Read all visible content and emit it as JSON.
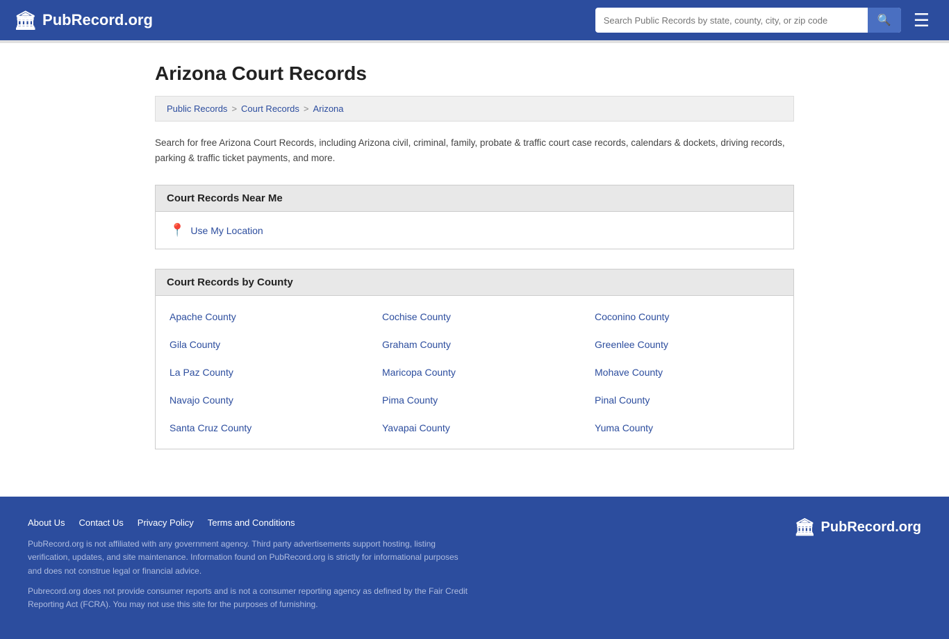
{
  "header": {
    "logo_text": "PubRecord.org",
    "search_placeholder": "Search Public Records by state, county, city, or zip code"
  },
  "breadcrumb": {
    "items": [
      {
        "label": "Public Records",
        "href": "#"
      },
      {
        "label": "Court Records",
        "href": "#"
      },
      {
        "label": "Arizona",
        "href": "#"
      }
    ]
  },
  "page_title": "Arizona Court Records",
  "description": "Search for free Arizona Court Records, including Arizona civil, criminal, family, probate & traffic court case records, calendars & dockets, driving records, parking & traffic ticket payments, and more.",
  "near_me": {
    "section_title": "Court Records Near Me",
    "location_label": "Use My Location"
  },
  "county_section": {
    "section_title": "Court Records by County",
    "counties": [
      {
        "col": 0,
        "label": "Apache County"
      },
      {
        "col": 1,
        "label": "Cochise County"
      },
      {
        "col": 2,
        "label": "Coconino County"
      },
      {
        "col": 0,
        "label": "Gila County"
      },
      {
        "col": 1,
        "label": "Graham County"
      },
      {
        "col": 2,
        "label": "Greenlee County"
      },
      {
        "col": 0,
        "label": "La Paz County"
      },
      {
        "col": 1,
        "label": "Maricopa County"
      },
      {
        "col": 2,
        "label": "Mohave County"
      },
      {
        "col": 0,
        "label": "Navajo County"
      },
      {
        "col": 1,
        "label": "Pima County"
      },
      {
        "col": 2,
        "label": "Pinal County"
      },
      {
        "col": 0,
        "label": "Santa Cruz County"
      },
      {
        "col": 1,
        "label": "Yavapai County"
      },
      {
        "col": 2,
        "label": "Yuma County"
      }
    ]
  },
  "footer": {
    "links": [
      {
        "label": "About Us"
      },
      {
        "label": "Contact Us"
      },
      {
        "label": "Privacy Policy"
      },
      {
        "label": "Terms and Conditions"
      }
    ],
    "text1": "PubRecord.org is not affiliated with any government agency. Third party advertisements support hosting, listing verification, updates, and site maintenance. Information found on PubRecord.org is strictly for informational purposes and does not construe legal or financial advice.",
    "text2": "Pubrecord.org does not provide consumer reports and is not a consumer reporting agency as defined by the Fair Credit Reporting Act (FCRA). You may not use this site for the purposes of furnishing.",
    "logo_text": "PubRecord.org"
  }
}
